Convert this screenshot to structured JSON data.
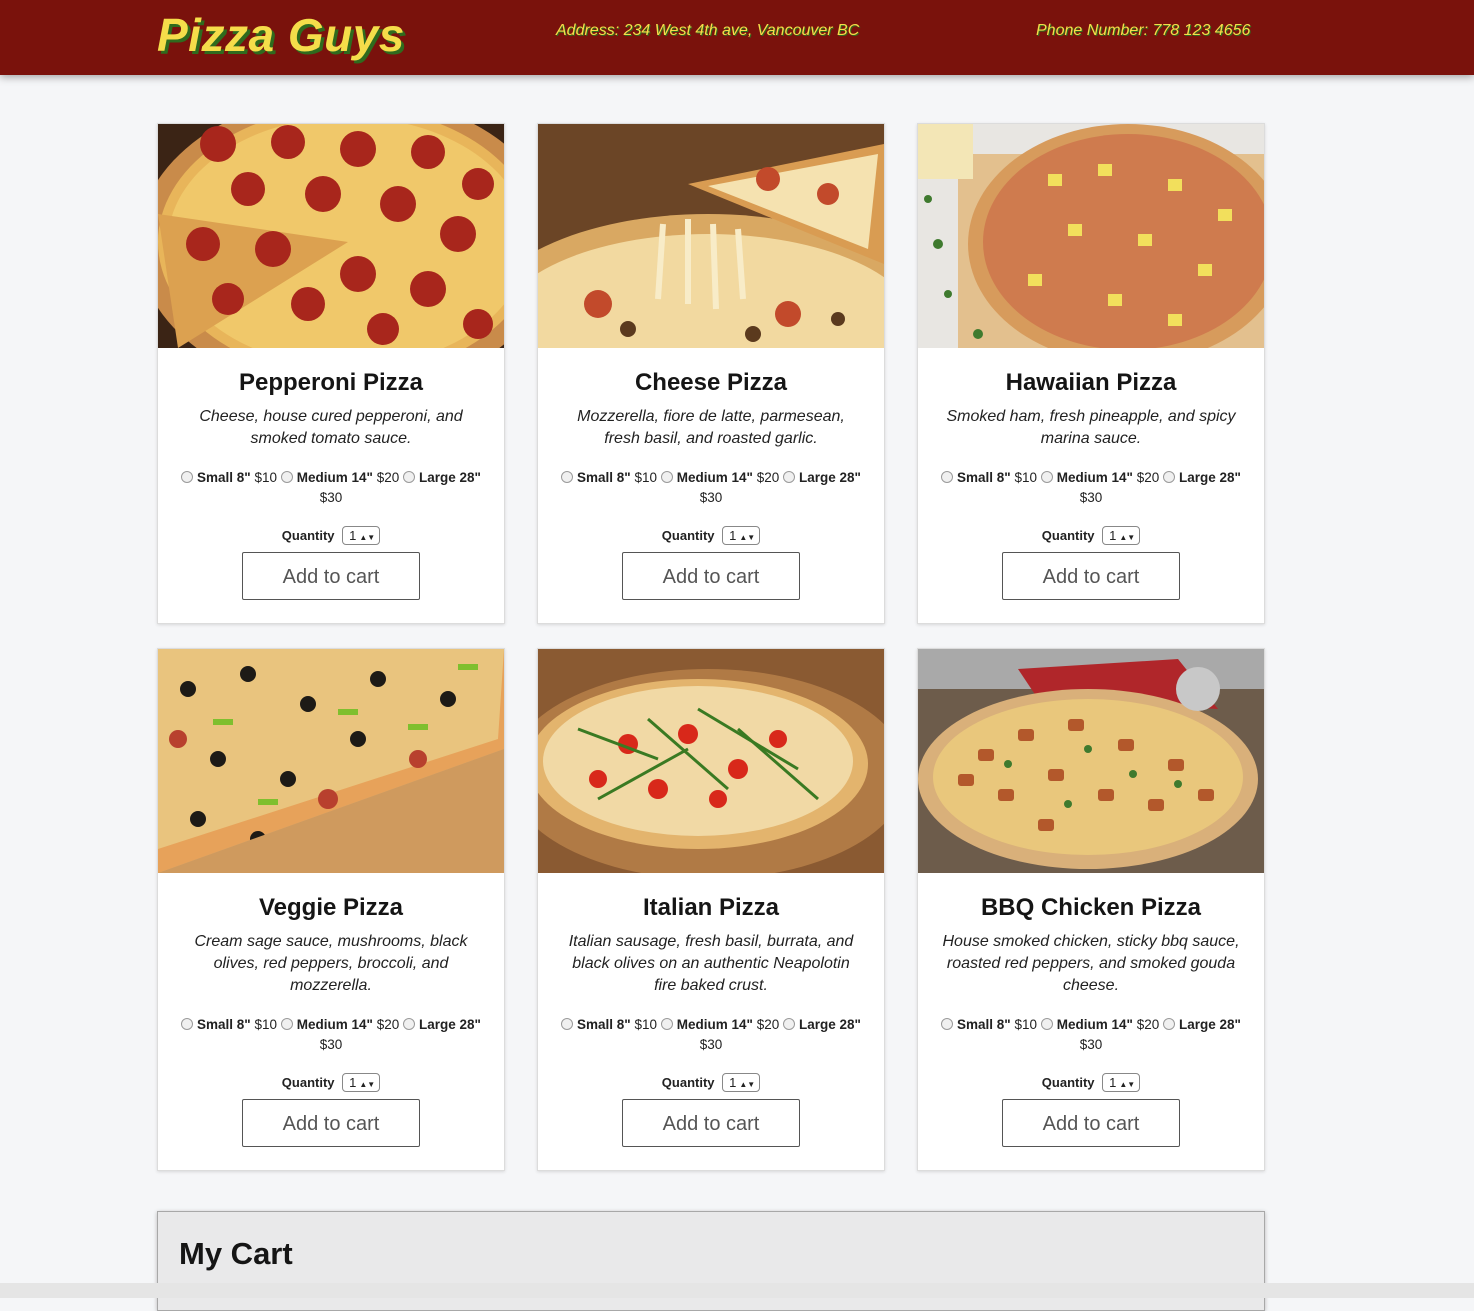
{
  "header": {
    "brand": "Pizza Guys",
    "address": "Address: 234 West 4th ave, Vancouver BC",
    "phone": "Phone Number: 778 123 4656"
  },
  "sizes": {
    "small_label": "Small 8\"",
    "small_price": "$10",
    "medium_label": "Medium 14\"",
    "medium_price": "$20",
    "large_label": "Large 28\"",
    "large_price": "$30"
  },
  "quantity": {
    "label": "Quantity",
    "value": "1"
  },
  "add_to_cart_label": "Add to cart",
  "products": [
    {
      "name": "Pepperoni Pizza",
      "description": "Cheese, house cured pepperoni, and smoked tomato sauce."
    },
    {
      "name": "Cheese Pizza",
      "description": "Mozzerella, fiore de latte, parmesean, fresh basil, and roasted garlic."
    },
    {
      "name": "Hawaiian Pizza",
      "description": "Smoked ham, fresh pineapple, and spicy marina sauce."
    },
    {
      "name": "Veggie Pizza",
      "description": "Cream sage sauce, mushrooms, black olives, red peppers, broccoli, and mozzerella."
    },
    {
      "name": "Italian Pizza",
      "description": "Italian sausage, fresh basil, burrata, and black olives on an authentic Neapolotin fire baked crust."
    },
    {
      "name": "BBQ Chicken Pizza",
      "description": "House smoked chicken, sticky bbq sauce, roasted red peppers, and smoked gouda cheese."
    }
  ],
  "cart": {
    "title": "My Cart"
  },
  "colors": {
    "header_bg": "#7a120c",
    "brand_yellow": "#f5dd4a",
    "brand_shadow": "#2f6b1e"
  }
}
